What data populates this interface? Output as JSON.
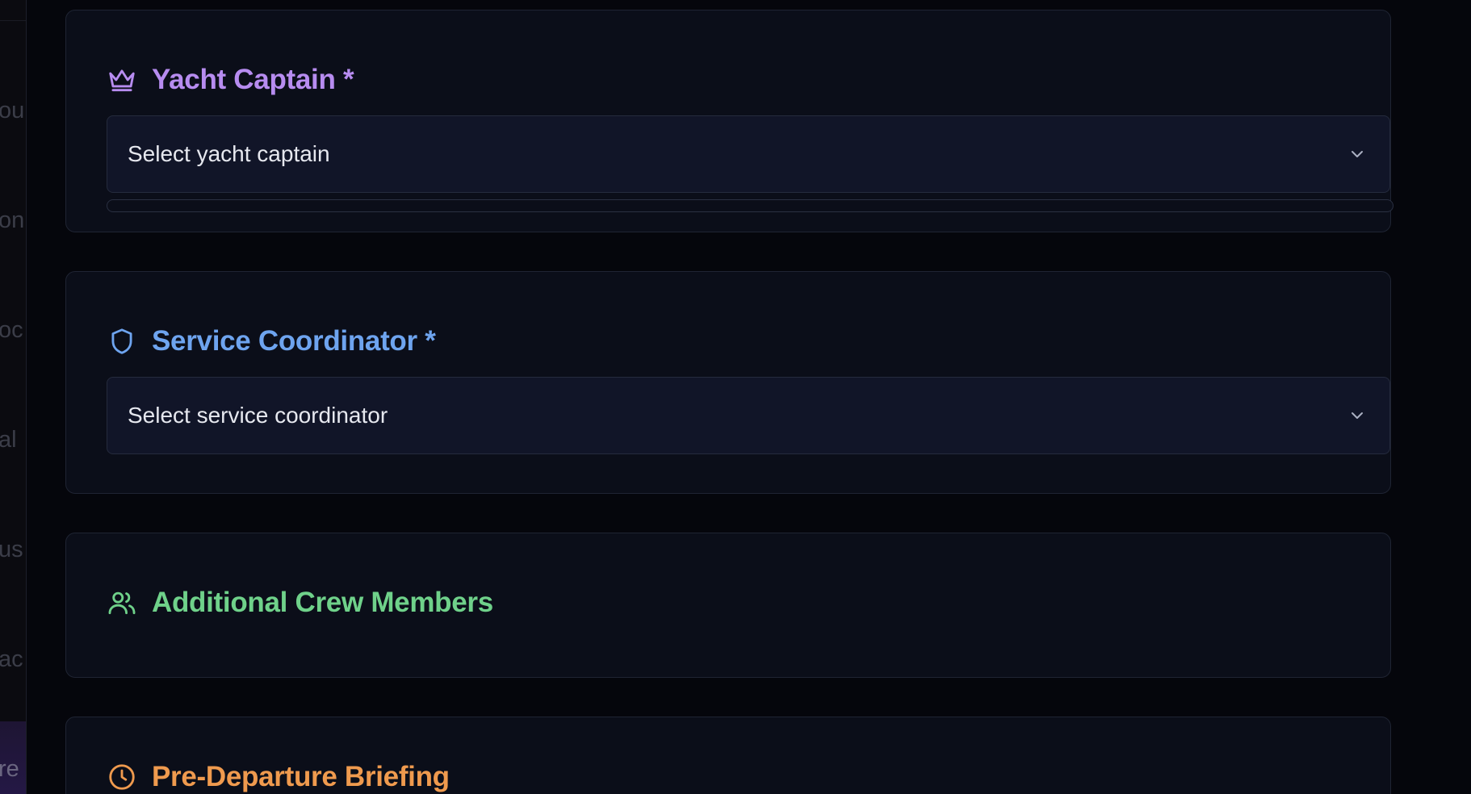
{
  "sidebar": {
    "fragments": [
      "ou",
      "on",
      "oc",
      "al",
      "us",
      "ac",
      "re"
    ]
  },
  "sections": {
    "captain": {
      "title": "Yacht Captain *",
      "icon": "crown-icon",
      "color": "#b78cf0",
      "select_placeholder": "Select yacht captain",
      "progress_fraction": 0
    },
    "coordinator": {
      "title": "Service Coordinator *",
      "icon": "shield-icon",
      "color": "#6ea4ef",
      "select_placeholder": "Select service coordinator"
    },
    "crew": {
      "title": "Additional Crew Members",
      "icon": "users-icon",
      "color": "#6fd18a"
    },
    "briefing": {
      "title": "Pre-Departure Briefing",
      "icon": "clock-icon",
      "color": "#ef9a4e"
    }
  }
}
